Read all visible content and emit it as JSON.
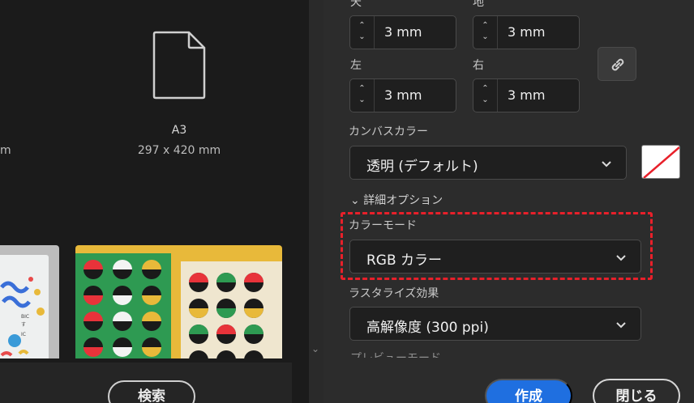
{
  "preset": {
    "name": "A3",
    "size": "297 x 420 mm",
    "size_cut": "m"
  },
  "footer_left": {
    "search_label": "検索"
  },
  "margins": {
    "top_label": "天",
    "bottom_label": "地",
    "left_label": "左",
    "right_label": "右",
    "top_value": "3 mm",
    "bottom_value": "3 mm",
    "left_value": "3 mm",
    "right_value": "3 mm"
  },
  "canvas_color": {
    "label": "カンバスカラー",
    "value": "透明 (デフォルト)"
  },
  "advanced_options": {
    "label": "詳細オプション"
  },
  "color_mode": {
    "label": "カラーモード",
    "value": "RGB カラー"
  },
  "rasterize": {
    "label": "ラスタライズ効果",
    "value": "高解像度 (300 ppi)"
  },
  "preview_mode": {
    "label": "プレビューモード"
  },
  "buttons": {
    "create": "作成",
    "close": "閉じる"
  },
  "colors": {
    "accent": "#1f6fe0",
    "highlight": "#e8202a",
    "panel": "#2c2c2c"
  }
}
